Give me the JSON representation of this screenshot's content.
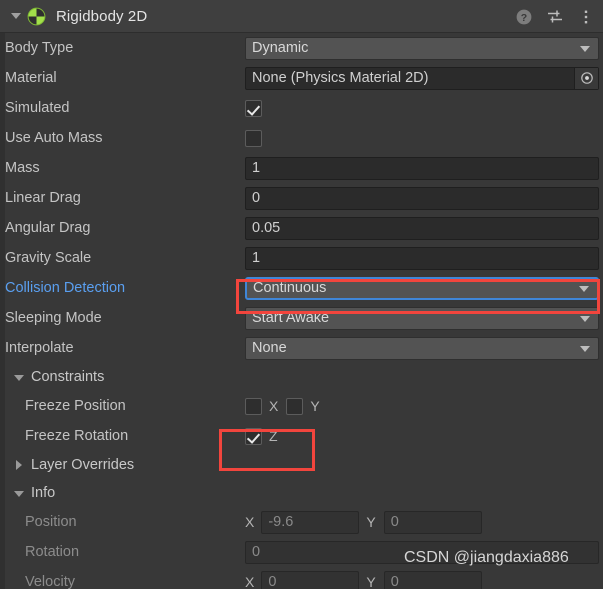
{
  "header": {
    "title": "Rigidbody 2D",
    "foldout_state": "expanded",
    "component_icon": "rigidbody2d-icon",
    "help_icon": "help-icon",
    "preset_icon": "preset-sliders-icon",
    "menu_icon": "kebab-menu-icon"
  },
  "colors": {
    "panel_bg": "#383838",
    "header_bg": "#3f3f3f",
    "field_bg": "#2b2b2b",
    "dropdown_bg": "#535353",
    "label": "#c4c4c4",
    "label_muted": "#8c8c8c",
    "label_modified": "#5a9ff0",
    "focus_border": "#3f86d8",
    "annotation_red": "#f2453d",
    "icon_green": "#a2e04a"
  },
  "properties": [
    {
      "label": "Body Type",
      "control": "dropdown",
      "value": "Dynamic"
    },
    {
      "label": "Material",
      "control": "object",
      "value": "None (Physics Material 2D)",
      "picker_icon": "object-picker-icon"
    },
    {
      "label": "Simulated",
      "control": "checkbox",
      "checked": true
    },
    {
      "label": "Use Auto Mass",
      "control": "checkbox",
      "checked": false
    },
    {
      "label": "Mass",
      "control": "text",
      "value": "1"
    },
    {
      "label": "Linear Drag",
      "control": "text",
      "value": "0"
    },
    {
      "label": "Angular Drag",
      "control": "text",
      "value": "0.05"
    },
    {
      "label": "Gravity Scale",
      "control": "text",
      "value": "1"
    },
    {
      "label": "Collision Detection",
      "control": "dropdown",
      "value": "Continuous",
      "modified": true,
      "focused": true,
      "annotated": true
    },
    {
      "label": "Sleeping Mode",
      "control": "dropdown",
      "value": "Start Awake"
    },
    {
      "label": "Interpolate",
      "control": "dropdown",
      "value": "None"
    }
  ],
  "constraints": {
    "title": "Constraints",
    "expanded": true,
    "freeze_position": {
      "label": "Freeze Position",
      "x": {
        "axis": "X",
        "checked": false
      },
      "y": {
        "axis": "Y",
        "checked": false
      }
    },
    "freeze_rotation": {
      "label": "Freeze Rotation",
      "z": {
        "axis": "Z",
        "checked": true
      },
      "annotated": true
    }
  },
  "layer_overrides": {
    "title": "Layer Overrides",
    "expanded": false
  },
  "info": {
    "title": "Info",
    "expanded": true,
    "rows": [
      {
        "label": "Position",
        "type": "vector2",
        "x_axis": "X",
        "x_value": "-9.6",
        "y_axis": "Y",
        "y_value": "0"
      },
      {
        "label": "Rotation",
        "type": "single",
        "value": "0"
      },
      {
        "label": "Velocity",
        "type": "vector2",
        "x_axis": "X",
        "x_value": "0",
        "y_axis": "Y",
        "y_value": "0"
      }
    ]
  },
  "watermark": "CSDN @jiangdaxia886"
}
